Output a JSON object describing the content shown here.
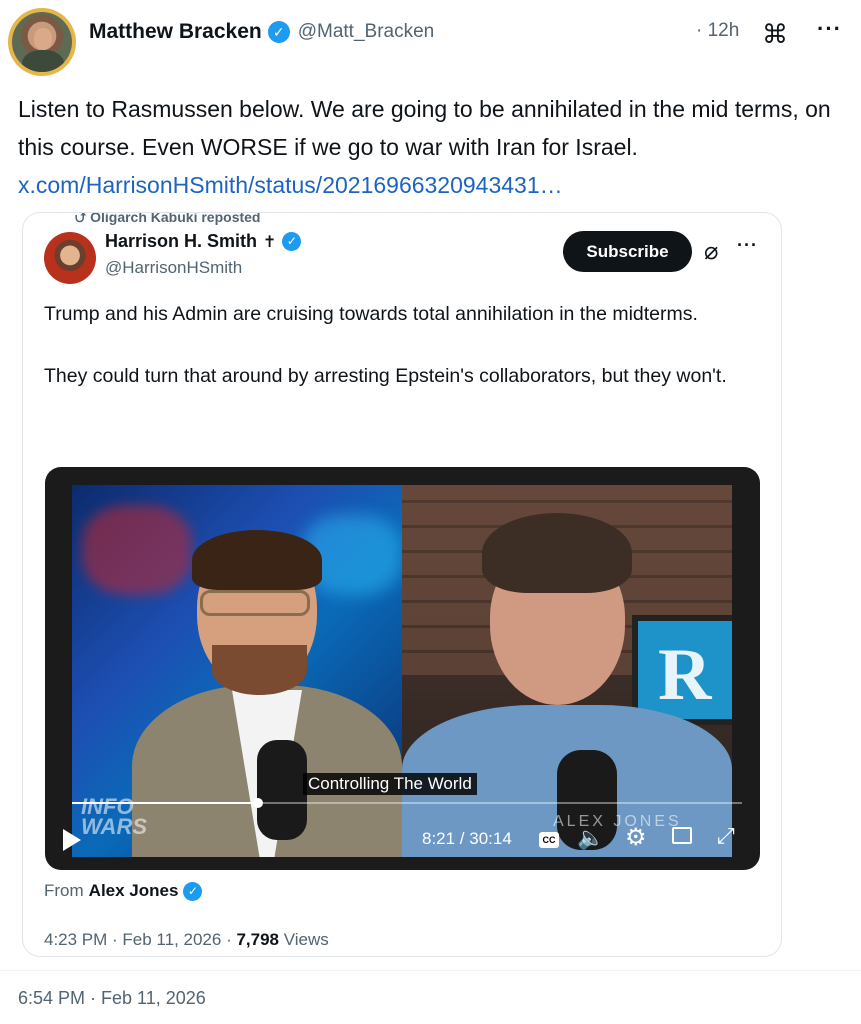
{
  "author": {
    "name": "Matthew Bracken",
    "verified_glyph": "✓",
    "handle": "@Matt_Bracken",
    "time_ago": "· 12h",
    "more_glyph": "···",
    "cmd_glyph": "⌘"
  },
  "tweet": {
    "text": "Listen to Rasmussen below. We are going to be annihilated in the mid terms, on this course. Even WORSE if we go to war with Iran for Israel.",
    "link": "x.com/HarrisonHSmith/status/20216966320943431…",
    "timestamp": "6:54 PM · Feb 11, 2026"
  },
  "quote": {
    "repost_label": "⮍ Oligarch Kabuki reposted",
    "name": "Harrison H. Smith",
    "name_suffix": "✝",
    "handle": "@HarrisonHSmith",
    "subscribe_label": "Subscribe",
    "grok_glyph": "⌀",
    "more_glyph": "···",
    "text_p1": "Trump and his Admin are cruising towards total annihilation in the midterms.",
    "text_p2": "They could turn that around by arresting Epstein's collaborators, but they won't.",
    "from_label": "From",
    "from_name": "Alex Jones",
    "time": "4:23 PM · Feb 11, 2026 · ",
    "views_count": "7,798",
    "views_label": " Views"
  },
  "video": {
    "caption": "Controlling The World",
    "watermark_left": "INFO\nWARS",
    "watermark_right": "ALEX JONES",
    "monitor_letter": "R",
    "time_display": "8:21 / 30:14",
    "cc_label": "CC",
    "volume_glyph": "🔈",
    "settings_glyph": "⚙",
    "fullscreen_glyph": "⤢",
    "progress_fraction": 0.277
  },
  "colors": {
    "accent": "#1d9bf0",
    "link": "#1d64c2",
    "secondary_text": "#536471",
    "avatar_ring": "#e7b548"
  }
}
